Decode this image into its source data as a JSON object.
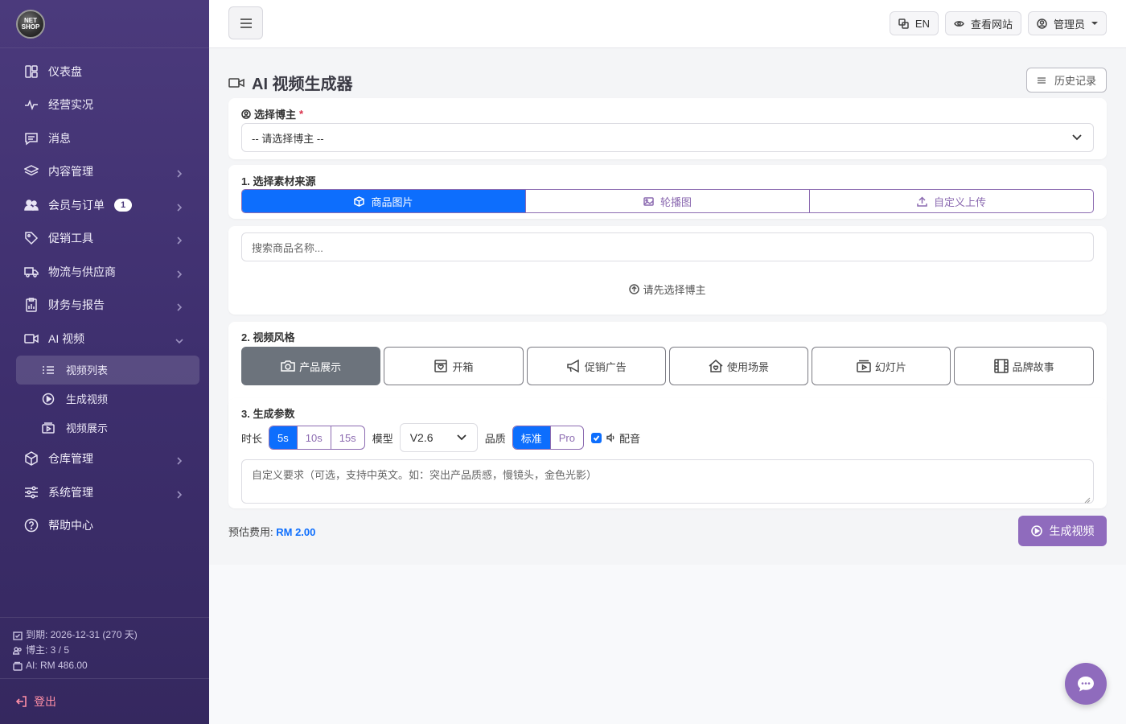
{
  "sidebar": {
    "logo_text_1": "NET",
    "logo_text_2": "SHOP",
    "items": [
      {
        "label": "仪表盘"
      },
      {
        "label": "经营实况"
      },
      {
        "label": "消息"
      },
      {
        "label": "内容管理"
      },
      {
        "label": "会员与订单",
        "badge": "1"
      },
      {
        "label": "促销工具"
      },
      {
        "label": "物流与供应商"
      },
      {
        "label": "财务与报告"
      },
      {
        "label": "AI 视频"
      },
      {
        "label": "仓库管理"
      },
      {
        "label": "系统管理"
      },
      {
        "label": "帮助中心"
      }
    ],
    "sub_items": [
      {
        "label": "视频列表"
      },
      {
        "label": "生成视频"
      },
      {
        "label": "视频展示"
      }
    ],
    "info": {
      "expiry": "到期: 2026-12-31 (270 天)",
      "bloggers": "博主: 3 / 5",
      "ai_balance": "AI: RM 486.00"
    },
    "logout": "登出"
  },
  "topbar": {
    "lang": "EN",
    "view_site": "查看网站",
    "admin": "管理员"
  },
  "page": {
    "title": "AI 视频生成器",
    "history": "历史记录"
  },
  "blogger": {
    "label": "选择博主",
    "required": "*",
    "placeholder": "-- 请选择博主 --"
  },
  "source": {
    "label": "1. 选择素材来源",
    "options": [
      "商品图片",
      "轮播图",
      "自定义上传"
    ],
    "selected": "商品图片"
  },
  "product_search": {
    "placeholder": "搜索商品名称...",
    "hint": "请先选择博主"
  },
  "style": {
    "label": "2. 视频风格",
    "options": [
      "产品展示",
      "开箱",
      "促销广告",
      "使用场景",
      "幻灯片",
      "品牌故事"
    ],
    "selected": "产品展示"
  },
  "params": {
    "label": "3. 生成参数",
    "duration_label": "时长",
    "durations": [
      "5s",
      "10s",
      "15s"
    ],
    "duration_selected": "5s",
    "model_label": "模型",
    "model_value": "V2.6",
    "quality_label": "品质",
    "qualities": [
      "标准",
      "Pro"
    ],
    "quality_selected": "标准",
    "voiceover_label": "配音",
    "voiceover_checked": true,
    "custom_placeholder": "自定义要求（可选，支持中英文。如：突出产品质感，慢镜头，金色光影）"
  },
  "footer": {
    "cost_label": "预估费用:",
    "cost_value": "RM 2.00",
    "generate": "生成视频"
  },
  "colors": {
    "sidebar": "#3e2f6e",
    "accent_blue": "#0d6efd",
    "accent_purple": "#8f6bbd"
  }
}
